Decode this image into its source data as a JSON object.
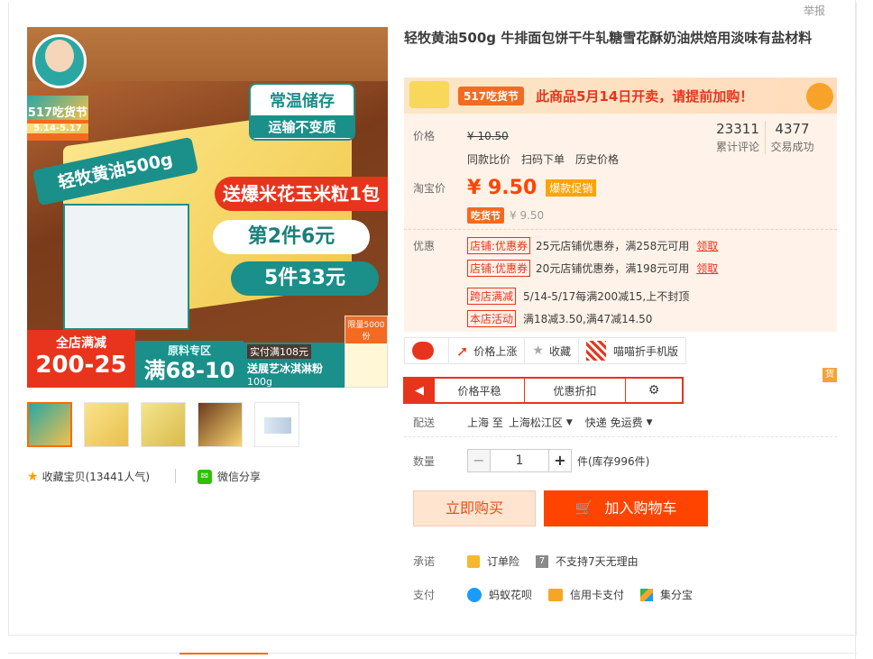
{
  "report": "举报",
  "gallery": {
    "main": {
      "badge_top": "517吃货节",
      "badge_date": "5.14-5.17",
      "tag_line1": "常温储存",
      "tag_line2": "运输不变质",
      "title_band": "轻牧黄油500g",
      "promo1": "送爆米花玉米粒1包",
      "promo2": "第2件6元",
      "promo3": "5件33元",
      "bottom_left_a": "全店满减",
      "bottom_left_b": "200-25",
      "bottom_mid_a": "原料专区",
      "bottom_mid_b": "满68-10",
      "bottom_right_a": "实付满108元",
      "bottom_right_b": "送展艺冰淇淋粉",
      "bottom_right_c": "100g",
      "gift_label": "限量5000份"
    },
    "thumbs": [
      "t1",
      "t2",
      "t3",
      "t4",
      "t5"
    ],
    "favorite": "收藏宝贝",
    "favorite_count": "(13441人气)",
    "share": "微信分享"
  },
  "product": {
    "title": "轻牧黄油500g 牛排面包饼干牛轧糖雪花酥奶油烘焙用淡味有盐材料",
    "banner_logo": "517吃货节",
    "banner_msg": "此商品5月14日开卖，请提前加购！",
    "price_label": "价格",
    "old_price": "¥ 10.50",
    "review_count": "23311",
    "review_label": "累计评论",
    "deal_count": "4377",
    "deal_label": "交易成功",
    "links": [
      "同款比价",
      "扫码下单",
      "历史价格"
    ],
    "taobao_label": "淘宝价",
    "price": "¥ 9.50",
    "hot_tag": "爆款促销",
    "festival_tag": "吃货节",
    "festival_price": "¥ 9.50",
    "promo_label": "优惠",
    "coupons": [
      {
        "tag": "店铺:优惠券",
        "text": "25元店铺优惠券，满258元可用",
        "action": "领取"
      },
      {
        "tag": "店铺:优惠券",
        "text": "20元店铺优惠券，满198元可用",
        "action": "领取"
      }
    ],
    "activities": [
      {
        "tag": "跨店满减",
        "text": "5/14-5/17每满200减15,上不封顶"
      },
      {
        "tag": "本店活动",
        "text": "满18减3.50,满47减14.50"
      }
    ]
  },
  "tools": {
    "price_up": "价格上涨",
    "collect": "收藏",
    "mobile": "喵喵折手机版"
  },
  "pricebar": {
    "stable": "价格平稳",
    "discount": "优惠折扣",
    "settings_icon": "⚙"
  },
  "huo": "货",
  "delivery": {
    "label": "配送",
    "from": "上海 至",
    "to": "上海松江区",
    "method": "快递 免运费"
  },
  "quantity": {
    "label": "数量",
    "value": "1",
    "stock": "件(库存996件)"
  },
  "actions": {
    "buy_now": "立即购买",
    "add_cart": "加入购物车"
  },
  "promise": {
    "label": "承诺",
    "items": [
      "订单险",
      "不支持7天无理由"
    ]
  },
  "payment": {
    "label": "支付",
    "items": [
      "蚂蚁花呗",
      "信用卡支付",
      "集分宝"
    ]
  }
}
